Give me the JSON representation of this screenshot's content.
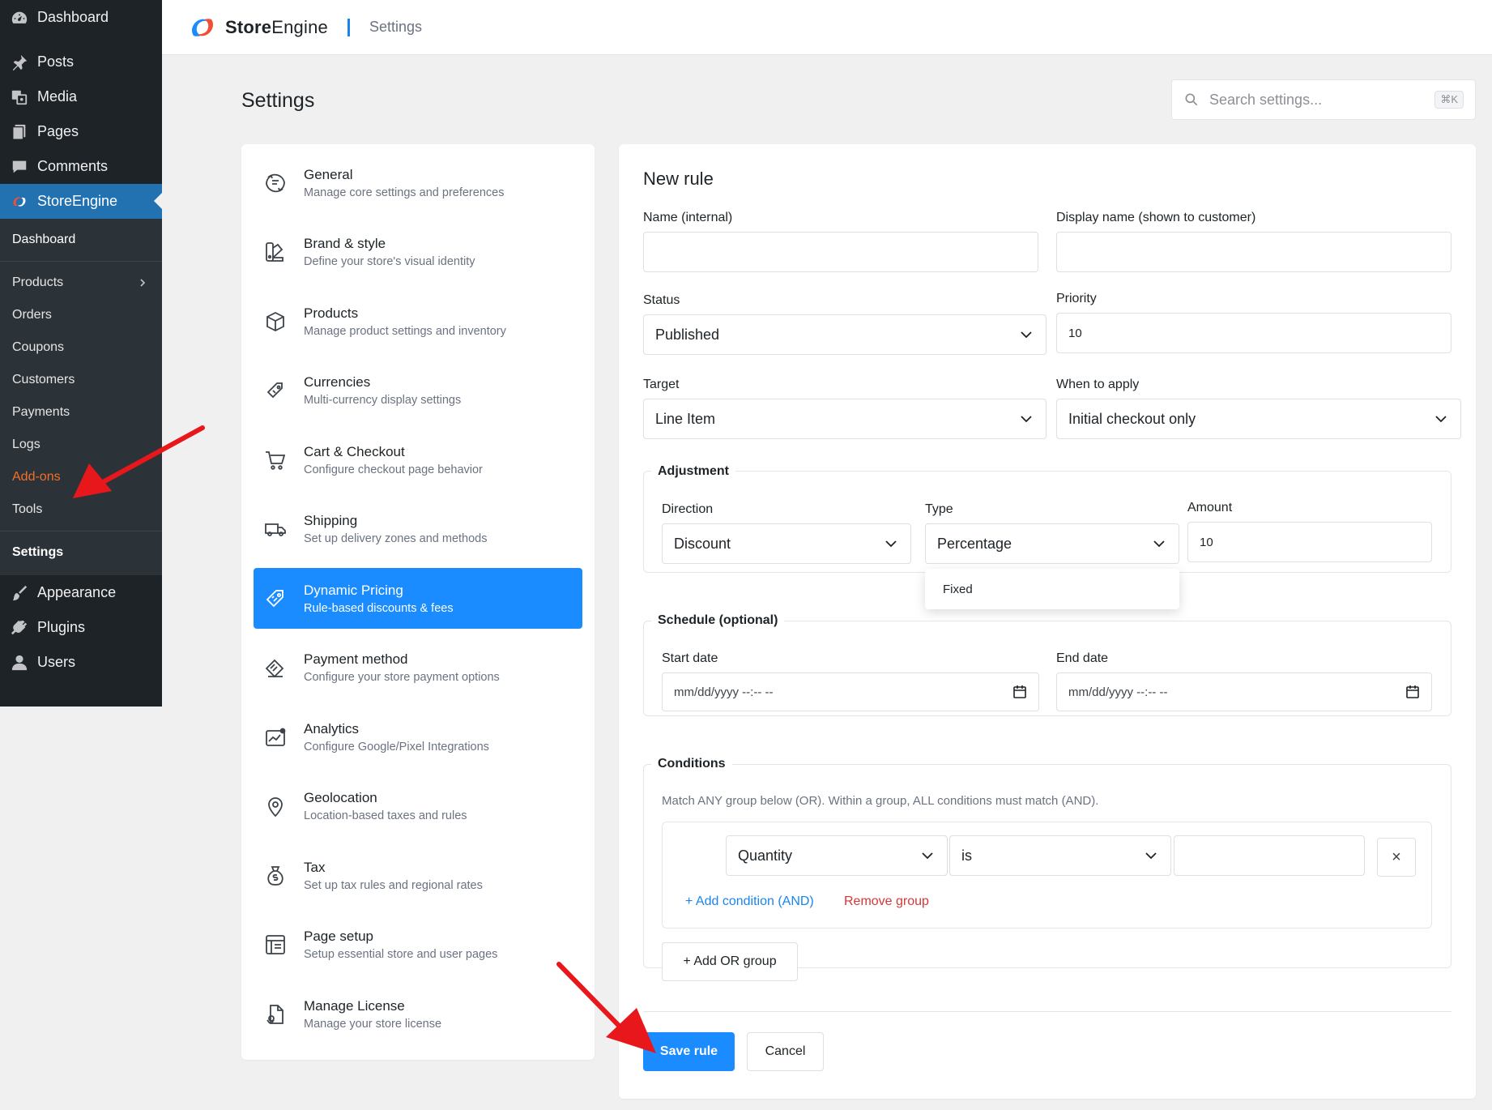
{
  "wp_menu": {
    "dashboard": "Dashboard",
    "posts": "Posts",
    "media": "Media",
    "pages": "Pages",
    "comments": "Comments",
    "storeengine": "StoreEngine",
    "submenu": [
      "Dashboard",
      "Products",
      "Orders",
      "Coupons",
      "Customers",
      "Payments",
      "Logs",
      "Add-ons",
      "Tools",
      "Settings"
    ],
    "appearance": "Appearance",
    "plugins": "Plugins",
    "users": "Users"
  },
  "topbar": {
    "brand_bold": "Store",
    "brand_light": "Engine",
    "breadcrumb": "Settings"
  },
  "page": {
    "title": "Settings",
    "search_placeholder": "Search settings...",
    "search_shortcut": "⌘K"
  },
  "settings_nav": [
    {
      "title": "General",
      "desc": "Manage core settings and preferences",
      "icon": "general-icon"
    },
    {
      "title": "Brand & style",
      "desc": "Define your store's visual identity",
      "icon": "brand-style-icon"
    },
    {
      "title": "Products",
      "desc": "Manage product settings and inventory",
      "icon": "box-icon"
    },
    {
      "title": "Currencies",
      "desc": "Multi-currency display settings",
      "icon": "currency-icon"
    },
    {
      "title": "Cart & Checkout",
      "desc": "Configure checkout page behavior",
      "icon": "cart-icon"
    },
    {
      "title": "Shipping",
      "desc": "Set up delivery zones and methods",
      "icon": "truck-icon"
    },
    {
      "title": "Dynamic Pricing",
      "desc": "Rule-based discounts & fees",
      "icon": "price-tag-icon"
    },
    {
      "title": "Payment method",
      "desc": "Configure your store payment options",
      "icon": "payment-icon"
    },
    {
      "title": "Analytics",
      "desc": "Configure Google/Pixel Integrations",
      "icon": "analytics-icon"
    },
    {
      "title": "Geolocation",
      "desc": "Location-based taxes and rules",
      "icon": "location-pin-icon"
    },
    {
      "title": "Tax",
      "desc": "Set up tax rules and regional rates",
      "icon": "money-bag-icon"
    },
    {
      "title": "Page setup",
      "desc": "Setup essential store and user pages",
      "icon": "page-layout-icon"
    },
    {
      "title": "Manage License",
      "desc": "Manage your store license",
      "icon": "license-icon"
    }
  ],
  "form": {
    "title": "New rule",
    "name_label": "Name (internal)",
    "name_value": "",
    "display_name_label": "Display name (shown to customer)",
    "display_name_value": "",
    "status_label": "Status",
    "status_value": "Published",
    "priority_label": "Priority",
    "priority_value": "10",
    "target_label": "Target",
    "target_value": "Line Item",
    "when_label": "When to apply",
    "when_value": "Initial checkout only",
    "adjustment": {
      "legend": "Adjustment",
      "direction_label": "Direction",
      "direction_value": "Discount",
      "type_label": "Type",
      "type_value": "Percentage",
      "type_dropdown_option": "Fixed",
      "amount_label": "Amount",
      "amount_value": "10"
    },
    "schedule": {
      "legend": "Schedule (optional)",
      "start_label": "Start date",
      "start_value": "mm/dd/yyyy --:-- --",
      "end_label": "End date",
      "end_value": "mm/dd/yyyy --:-- --"
    },
    "conditions": {
      "legend": "Conditions",
      "help": "Match ANY group below (OR). Within a group, ALL conditions must match (AND).",
      "field_value": "Quantity",
      "operator_value": "is",
      "condition_value": "",
      "remove_symbol": "×",
      "add_condition": "+ Add condition (AND)",
      "remove_group": "Remove group",
      "add_or_group": "+ Add OR group"
    },
    "save_label": "Save rule",
    "cancel_label": "Cancel"
  },
  "colors": {
    "accent": "#1a8cff",
    "wp_dark": "#1d2327",
    "annotation_arrow": "#e8171b"
  }
}
